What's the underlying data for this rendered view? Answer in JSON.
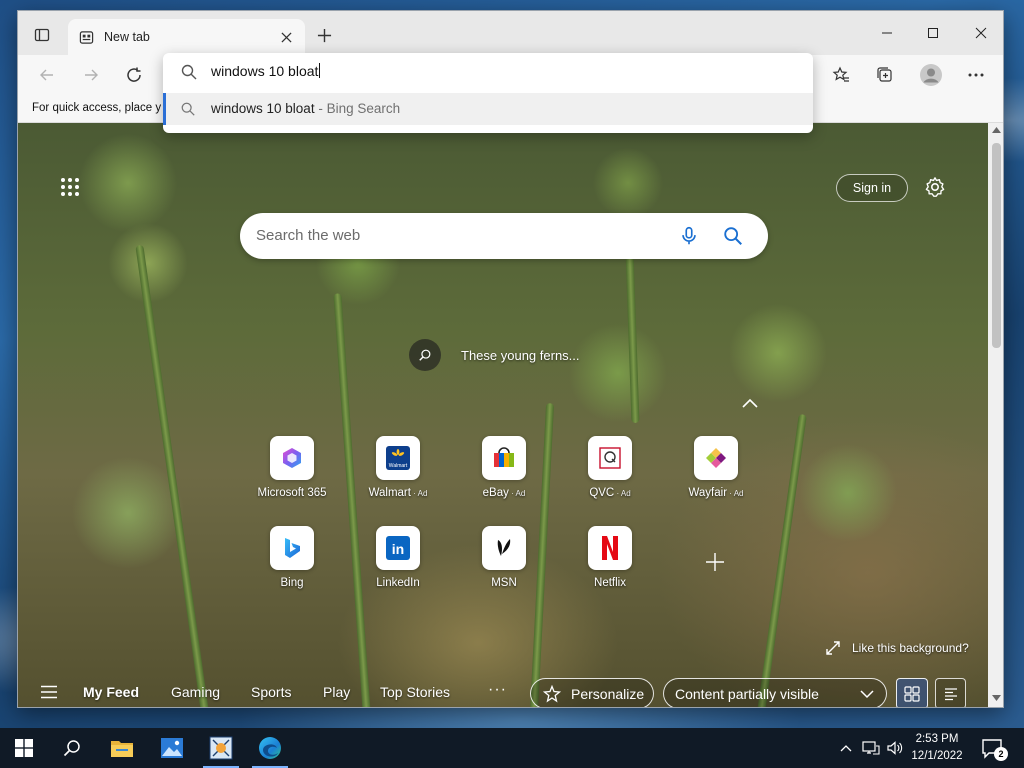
{
  "tab": {
    "title": "New tab"
  },
  "omnibox": {
    "input_value": "windows 10 bloat",
    "suggestion_text": "windows 10 bloat",
    "suggestion_suffix": " - Bing Search"
  },
  "favorites_bar": {
    "text": "For quick access, place y"
  },
  "newtab": {
    "signin_label": "Sign in",
    "search_placeholder": "Search the web",
    "bg_info_text": "These young ferns...",
    "like_background_text": "Like this background?"
  },
  "tiles": [
    {
      "label": "Microsoft 365",
      "ad": "",
      "icon": "microsoft-365-icon"
    },
    {
      "label": "Walmart",
      "ad": " · Ad",
      "icon": "walmart-icon"
    },
    {
      "label": "eBay",
      "ad": " · Ad",
      "icon": "ebay-icon"
    },
    {
      "label": "QVC",
      "ad": " · Ad",
      "icon": "qvc-icon"
    },
    {
      "label": "Wayfair",
      "ad": " · Ad",
      "icon": "wayfair-icon"
    },
    {
      "label": "Bing",
      "ad": "",
      "icon": "bing-icon"
    },
    {
      "label": "LinkedIn",
      "ad": "",
      "icon": "linkedin-icon"
    },
    {
      "label": "MSN",
      "ad": "",
      "icon": "msn-icon"
    },
    {
      "label": "Netflix",
      "ad": "",
      "icon": "netflix-icon"
    }
  ],
  "feed": {
    "tabs": [
      "My Feed",
      "Gaming",
      "Sports",
      "Play",
      "Top Stories"
    ],
    "more": "···",
    "personalize_label": "Personalize",
    "content_visibility": "Content partially visible"
  },
  "taskbar": {
    "time": "2:53 PM",
    "date": "12/1/2022",
    "notification_count": "2"
  },
  "colors": {
    "accent": "#2b6fd6",
    "taskbar": "#101a26",
    "netflix_red": "#e50914",
    "linkedin_blue": "#0a66c2"
  }
}
